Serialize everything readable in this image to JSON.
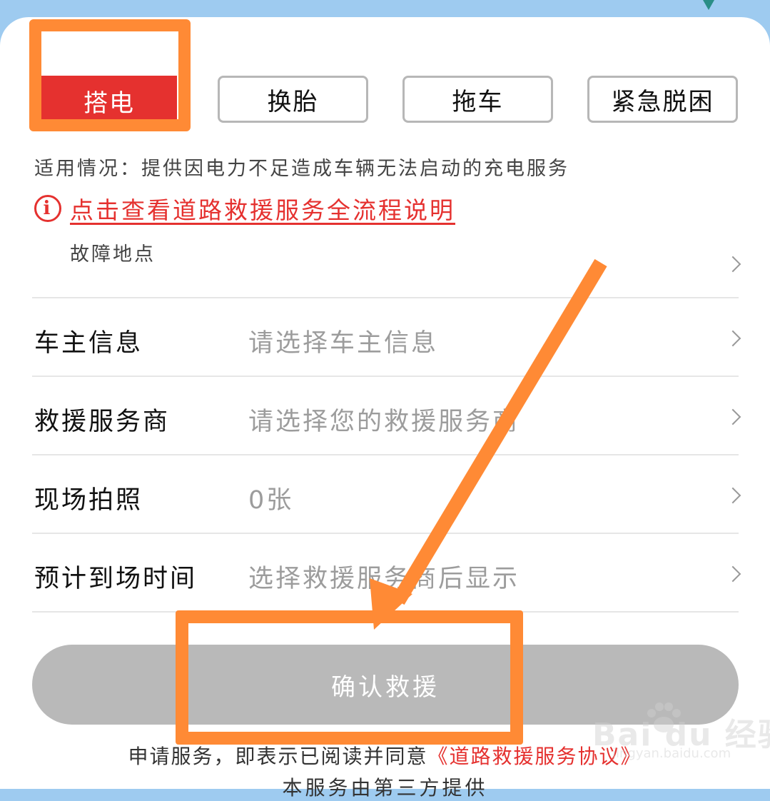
{
  "tabs": [
    {
      "label": "搭电",
      "active": true
    },
    {
      "label": "换胎",
      "active": false
    },
    {
      "label": "拖车",
      "active": false
    },
    {
      "label": "紧急脱困",
      "active": false
    }
  ],
  "applies_text": "适用情况：提供因电力不足造成车辆无法启动的充电服务",
  "process_link": {
    "icon": "info-circle-icon",
    "text": "点击查看道路救援服务全流程说明"
  },
  "location": {
    "label": "故障地点"
  },
  "rows": [
    {
      "label": "车主信息",
      "value": "请选择车主信息"
    },
    {
      "label": "救援服务商",
      "value": "请选择您的救援服务商"
    },
    {
      "label": "现场拍照",
      "value": "0张"
    },
    {
      "label": "预计到场时间",
      "value": "选择救援服务商后显示"
    }
  ],
  "confirm_label": "确认救援",
  "agreement": {
    "prefix": "申请服务，即表示已阅读并同意",
    "link": "《道路救援服务协议》"
  },
  "third_party": "本服务由第三方提供",
  "watermark": {
    "logo": "Bai du 经验",
    "sub": "jingyan.baidu.com"
  },
  "colors": {
    "accent_red": "#e5312f",
    "highlight_orange": "#ff8a35",
    "button_gray": "#b9b9b9",
    "top_bar_blue": "#9ecbf0"
  }
}
